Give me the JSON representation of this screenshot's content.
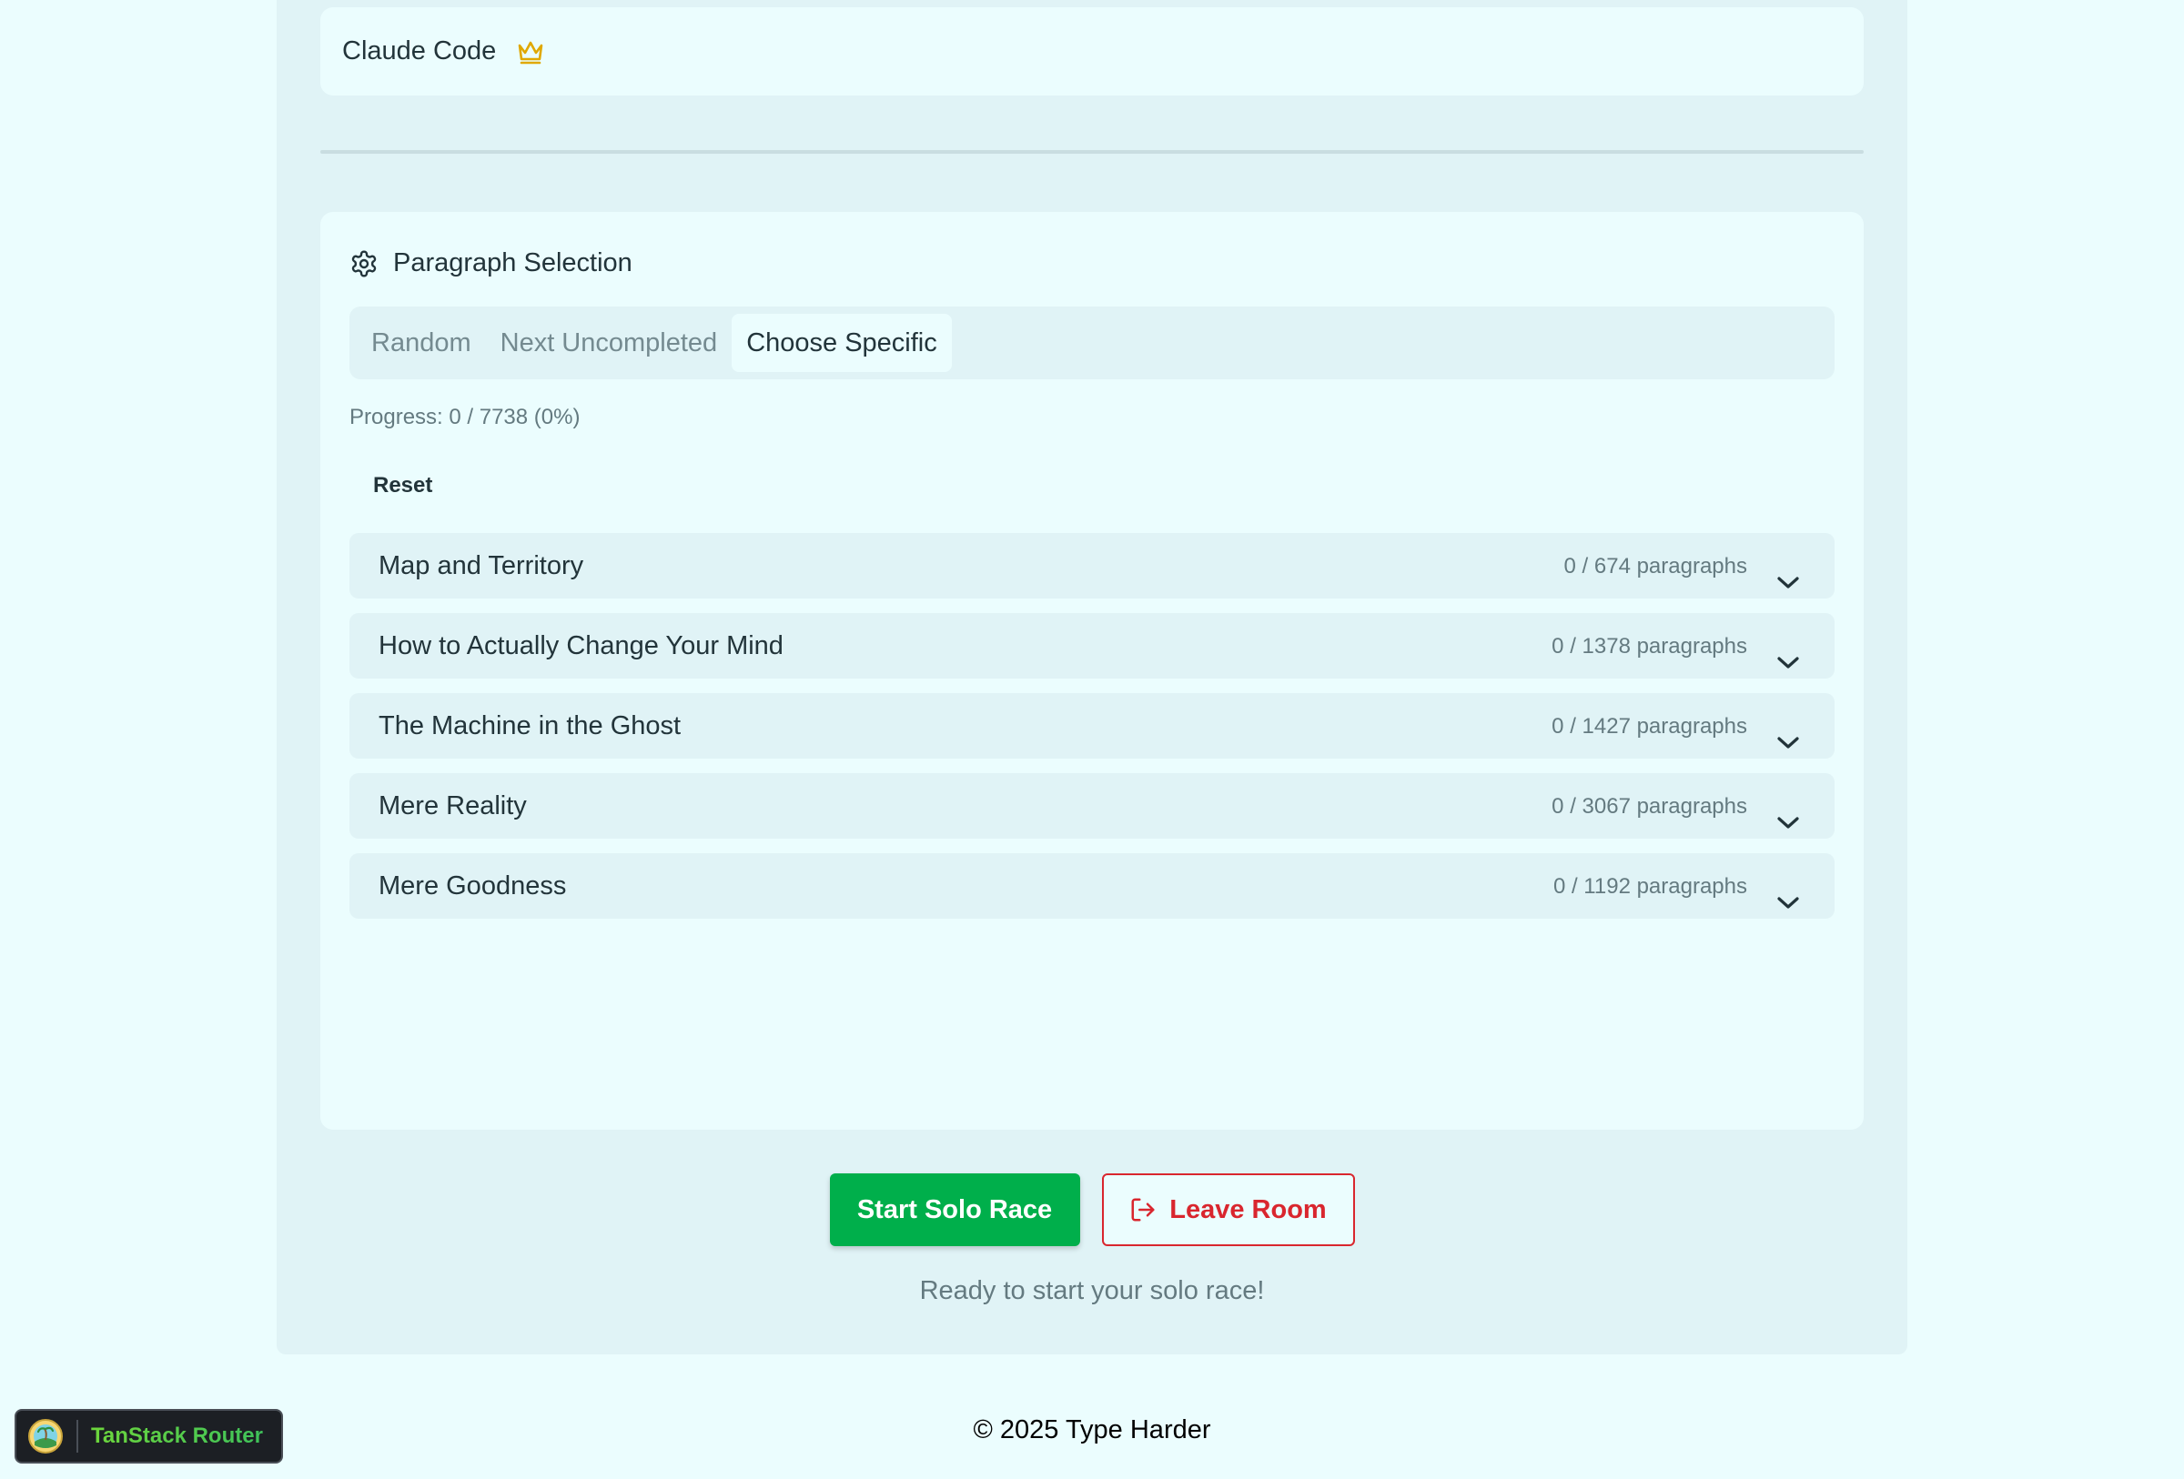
{
  "player": {
    "name": "Claude Code",
    "icon": "crown-icon",
    "icon_color": "#e0a800"
  },
  "paragraph_selection": {
    "title": "Paragraph Selection",
    "icon": "gear-icon",
    "tabs": [
      {
        "label": "Random",
        "active": false
      },
      {
        "label": "Next Uncompleted",
        "active": false
      },
      {
        "label": "Choose Specific",
        "active": true
      }
    ],
    "progress_text": "Progress: 0 / 7738 (0%)",
    "reset_label": "Reset",
    "books": [
      {
        "title": "Map and Territory",
        "count": "0 / 674 paragraphs"
      },
      {
        "title": "How to Actually Change Your Mind",
        "count": "0 / 1378 paragraphs"
      },
      {
        "title": "The Machine in the Ghost",
        "count": "0 / 1427 paragraphs"
      },
      {
        "title": "Mere Reality",
        "count": "0 / 3067 paragraphs"
      },
      {
        "title": "Mere Goodness",
        "count": "0 / 1192 paragraphs"
      }
    ]
  },
  "actions": {
    "start_label": "Start Solo Race",
    "leave_label": "Leave Room",
    "start_color": "#00af4b",
    "leave_color": "#d9262e"
  },
  "status_text": "Ready to start your solo race!",
  "footer": {
    "text": "© 2025 Type Harder"
  },
  "devtools": {
    "label": "TanStack Router"
  }
}
